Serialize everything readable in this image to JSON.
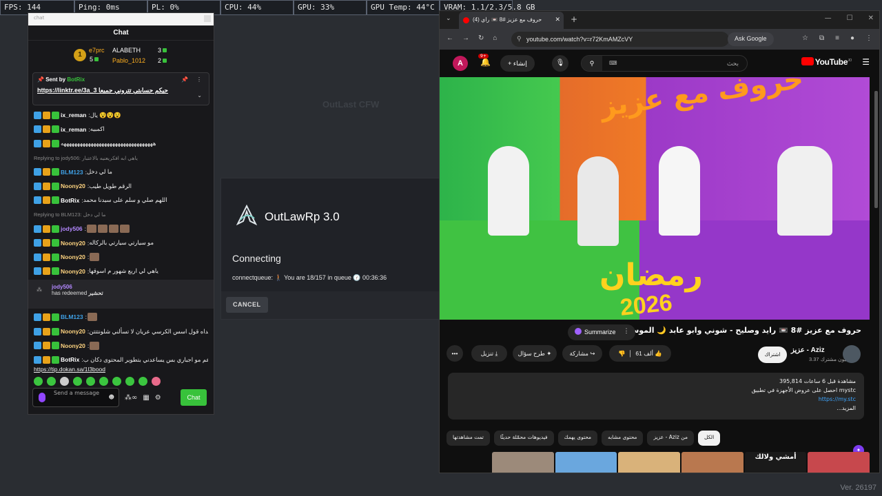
{
  "overlay": {
    "stats": [
      "FPS: 144",
      "Ping: 0ms",
      "PL: 0%",
      "CPU: 44%",
      "GPU: 33%",
      "GPU Temp: 44°C",
      "VRAM: 1.1/2.3/5.8 GB"
    ]
  },
  "background": {
    "menu_title": "OutLast CFW",
    "version": "Ver. 26197"
  },
  "chat": {
    "popout_label": "chat",
    "title": "Chat",
    "leaderboard": {
      "rank": "1",
      "first": {
        "name": "e7prc",
        "count": "5"
      },
      "second": {
        "name": "ALABETH",
        "count": "3"
      },
      "third": {
        "name": "Pablo_1012",
        "count": "2"
      }
    },
    "pinned": {
      "sent_by_label": "Sent by",
      "author": "BotRix",
      "text": "https://linktr.ee/3a_3 حيكم حسابتي تتروني جميعا"
    },
    "messages": [
      {
        "user": "ix_reman",
        "color": "#ffffff",
        "text": "يال 😵😵😵"
      },
      {
        "user": "ix_reman",
        "color": "#ffffff",
        "text": "اكمبيه"
      },
      {
        "user": "",
        "color": "#ffffff",
        "text": "ههههههههههههههههههههههههههههههههههه"
      },
      {
        "user": "",
        "color": "#888888",
        "text": "Replying to jody506: ياهي ابه افكريعنيه بالاعتبار",
        "reply": true
      },
      {
        "user": "BLM123",
        "color": "#3fa1e6",
        "text": "ما لي دخل"
      },
      {
        "user": "Noony20",
        "color": "#ffd480",
        "text": "الرقم طويل طيب"
      },
      {
        "user": "BotRix",
        "color": "#ffffff",
        "text": "اللهم صلي و سلم على سيدنا محمد"
      },
      {
        "user": "",
        "color": "#888888",
        "text": "Replying to BLM123: ما لي دخل",
        "reply": true
      },
      {
        "user": "jody506",
        "color": "#b388ff",
        "text": ""
      },
      {
        "user": "Noony20",
        "color": "#ffd480",
        "text": "مو سيارتي سيارتي بالركاله"
      },
      {
        "user": "Noony20",
        "color": "#ffd480",
        "text": ""
      },
      {
        "user": "Noony20",
        "color": "#ffd480",
        "text": "ياهي لي اربع شهور م اسوقها"
      }
    ],
    "redeem": {
      "user": "jody506",
      "action": "has redeemed",
      "reward": "تحشير"
    },
    "messages2": [
      {
        "user": "BLM123",
        "color": "#3fa1e6",
        "text": ""
      },
      {
        "user": "Noony20",
        "color": "#ffd480",
        "text": "وغيداه قول اسس الكرسي عريان لا تسألني شلونتتتن"
      },
      {
        "user": "Noony20",
        "color": "#ffd480",
        "text": ""
      },
      {
        "user": "BotRix",
        "color": "#ffffff",
        "text": "الدعم مو اجباري بس يساعدني بتطوير المحتوى دكان ب"
      }
    ],
    "tip_link": "https://tip.dokan.sa/1l3bood",
    "input_placeholder": "Send a message",
    "send_label": "Chat"
  },
  "dialog": {
    "title": "OutLawRp 3.0",
    "status": "Connecting",
    "queue": "connectqueue: 🚶🏽 You are 18/157 in queue 🕜 00:36:36",
    "cancel": "CANCEL"
  },
  "browser": {
    "tab_title": "(4) حروف مع عزيز #8 📼 راي",
    "url": "youtube.com/watch?v=r72KmAMZcVY",
    "ask_google": "Ask Google",
    "youtube": {
      "avatar_letter": "A",
      "notif_count": "9+",
      "create_label": "إنشاء",
      "search_placeholder": "بحث",
      "logo_text": "YouTube",
      "logo_region": "JO",
      "video_art_title": "حروف مع عزيز",
      "video_art_ramadan": "رمضان",
      "video_art_year": "2026",
      "video_title": "حروف مع عزيز #8 📼 رايد وصليح - شوني وابو عابد 🌙 الموسم الثالث",
      "summarize": "Summarize",
      "likes": "61 ألف",
      "share": "مشاركة",
      "ask": "طرح سؤال",
      "download": "تنزيل",
      "subscribe": "اشتراك",
      "channel": "عزيز - Aziz",
      "subscribers": "3.37 مليون مشترك",
      "desc_line1": "395,814 مشاهدة قبل 6 ساعات",
      "desc_line2": "احصل على عروض الأجهزة في تطبيق mystc",
      "desc_link": "https://my.stc",
      "desc_more": "...المزيد",
      "chips": [
        "الكل",
        "من Aziz - عزيز",
        "محتوى مشابه",
        "محتوى يهمك",
        "فيديوهات محمّلة حديثًا",
        "تمت مشاهدتها"
      ],
      "thumb_caption": "أمشي ولالك"
    }
  }
}
